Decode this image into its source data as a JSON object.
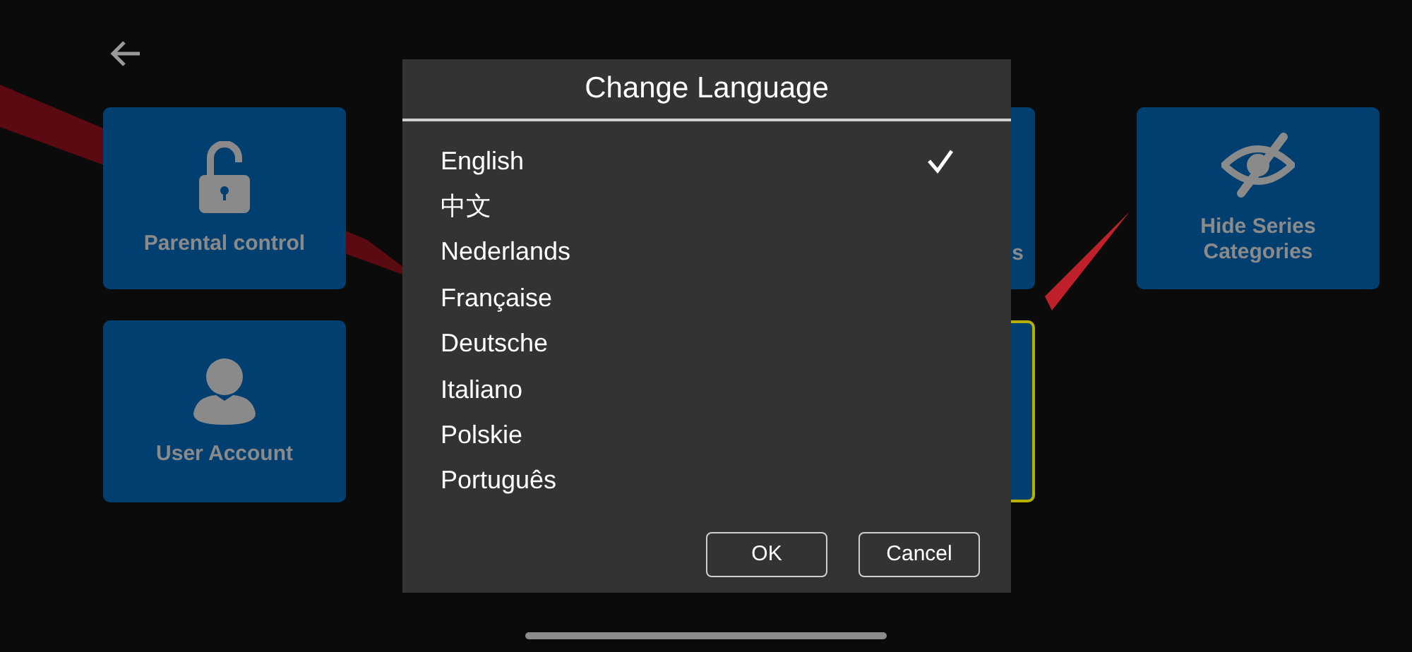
{
  "tiles": [
    {
      "kind": "lock",
      "label": "Parental control",
      "focused": false
    },
    {
      "kind": "hidden",
      "label": "s",
      "focused": false
    },
    {
      "kind": "eye-off",
      "label": "Hide Series Categories",
      "focused": false
    },
    {
      "kind": "user",
      "label": "User Account",
      "focused": false
    },
    {
      "kind": "hidden",
      "focused": true
    }
  ],
  "dialog": {
    "title": "Change Language",
    "languages": [
      {
        "label": "English",
        "selected": true
      },
      {
        "label": "中文",
        "selected": false
      },
      {
        "label": "Nederlands",
        "selected": false
      },
      {
        "label": "Française",
        "selected": false
      },
      {
        "label": "Deutsche",
        "selected": false
      },
      {
        "label": "Italiano",
        "selected": false
      },
      {
        "label": "Polskie",
        "selected": false
      },
      {
        "label": "Português",
        "selected": false
      }
    ],
    "buttons": [
      "OK",
      "Cancel"
    ]
  }
}
